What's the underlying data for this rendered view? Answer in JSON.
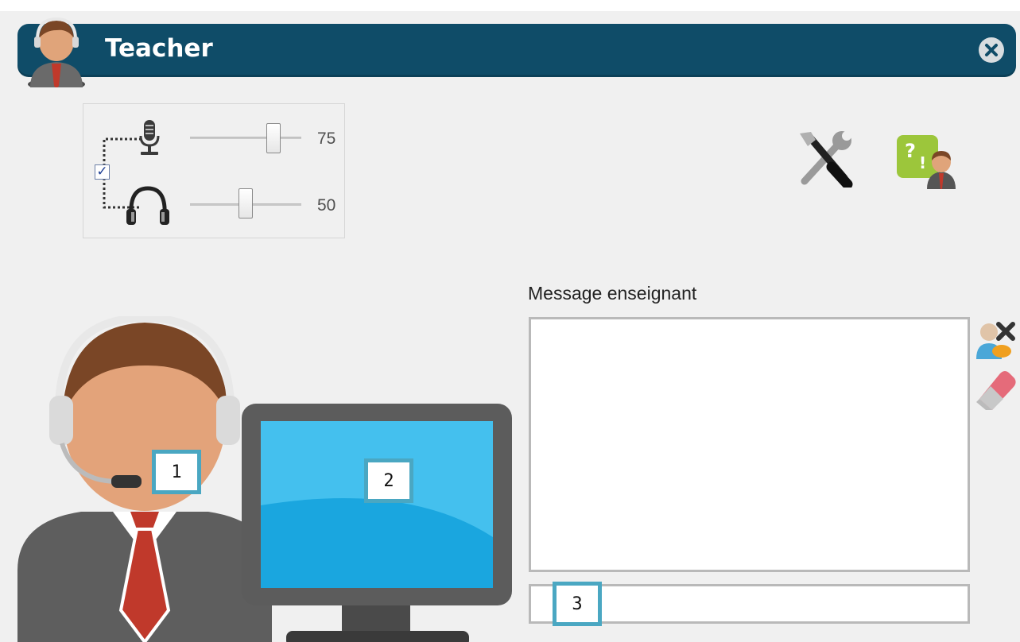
{
  "window": {
    "title": "Teacher",
    "title_bar_color": "#0f4c68"
  },
  "audio": {
    "microphone": {
      "icon": "microphone-icon",
      "value": "75",
      "level_fraction": 0.75
    },
    "headphones": {
      "icon": "headphones-icon",
      "value": "50",
      "level_fraction": 0.5
    },
    "linked_checkbox": {
      "checked": true,
      "glyph": "✓"
    }
  },
  "toolbar": {
    "settings_icon": "tools-icon",
    "help_icon": "teacher-help-icon"
  },
  "message": {
    "label": "Message enseignant",
    "text": "",
    "input_value": "",
    "clear_user_icon": "user-remove-icon",
    "eraser_icon": "eraser-icon"
  },
  "callouts": [
    "1",
    "2",
    "3"
  ],
  "colors": {
    "accent": "#4aa7c2",
    "monitor_screen": "#1aa6df",
    "tie": "#c0392b"
  }
}
